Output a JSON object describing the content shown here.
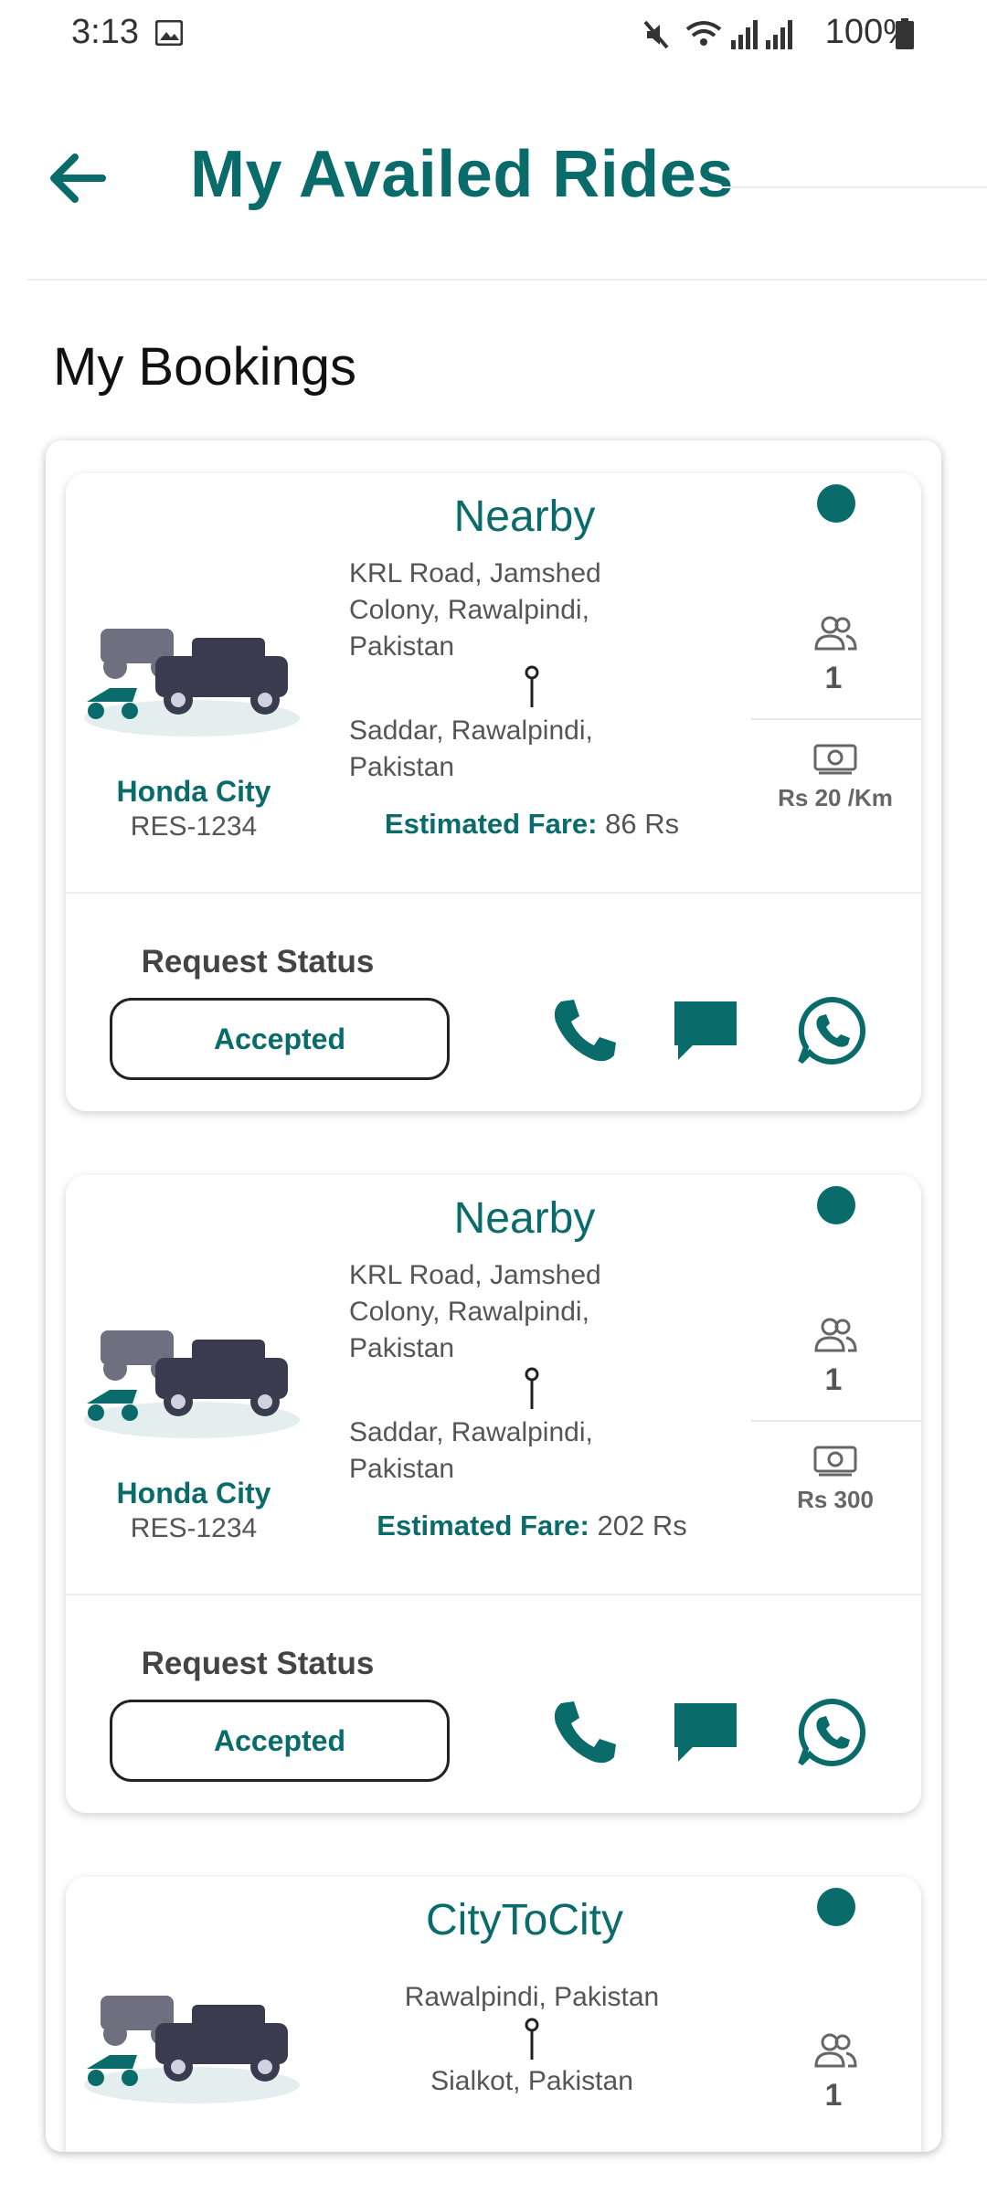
{
  "status_bar": {
    "time": "3:13",
    "battery": "100%"
  },
  "header": {
    "title": "My Availed Rides"
  },
  "section_title": "My Bookings",
  "colors": {
    "accent": "#0a6b6b"
  },
  "bookings": [
    {
      "type": "Nearby",
      "car_name": "Honda City",
      "car_reg": "RES-1234",
      "from_lines": [
        "KRL Road, Jamshed",
        "Colony, Rawalpindi,",
        "Pakistan"
      ],
      "to_lines": [
        "Saddar, Rawalpindi,",
        "Pakistan"
      ],
      "fare_label": "Estimated Fare:",
      "fare_value": "86 Rs",
      "seats": "1",
      "rate": "Rs 20 /Km",
      "request_status_label": "Request Status",
      "status": "Accepted"
    },
    {
      "type": "Nearby",
      "car_name": "Honda City",
      "car_reg": "RES-1234",
      "from_lines": [
        "KRL Road, Jamshed",
        "Colony, Rawalpindi,",
        "Pakistan"
      ],
      "to_lines": [
        "Saddar, Rawalpindi,",
        "Pakistan"
      ],
      "fare_label": "Estimated Fare:",
      "fare_value": "202 Rs",
      "seats": "1",
      "rate": "Rs 300",
      "request_status_label": "Request Status",
      "status": "Accepted"
    },
    {
      "type": "CityToCity",
      "from": "Rawalpindi, Pakistan",
      "to": "Sialkot, Pakistan",
      "seats": "1"
    }
  ],
  "icons": [
    "back-arrow-icon",
    "people-icon",
    "money-icon",
    "phone-icon",
    "chat-icon",
    "whatsapp-icon",
    "location-pin-icon"
  ]
}
